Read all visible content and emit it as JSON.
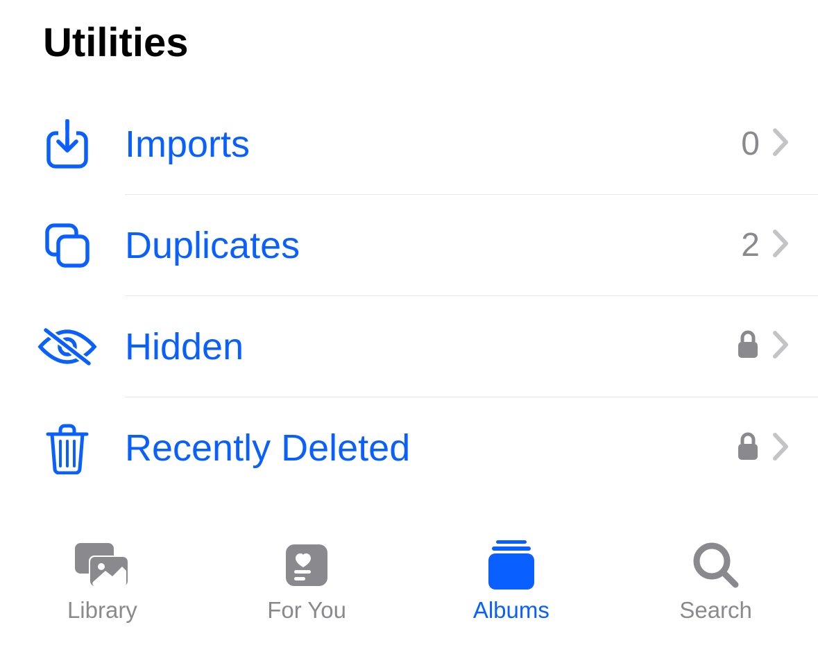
{
  "section": {
    "title": "Utilities",
    "items": [
      {
        "label": "Imports",
        "count": "0",
        "locked": false,
        "icon": "import-icon"
      },
      {
        "label": "Duplicates",
        "count": "2",
        "locked": false,
        "icon": "duplicates-icon"
      },
      {
        "label": "Hidden",
        "count": null,
        "locked": true,
        "icon": "hidden-icon"
      },
      {
        "label": "Recently Deleted",
        "count": null,
        "locked": true,
        "icon": "trash-icon"
      }
    ]
  },
  "tabs": {
    "library": "Library",
    "for_you": "For You",
    "albums": "Albums",
    "search": "Search",
    "active": "albums"
  },
  "colors": {
    "accent": "#0a60ff",
    "secondary_text": "#8a8a8e",
    "chevron": "#c4c4c6",
    "separator": "#e5e5ea"
  }
}
